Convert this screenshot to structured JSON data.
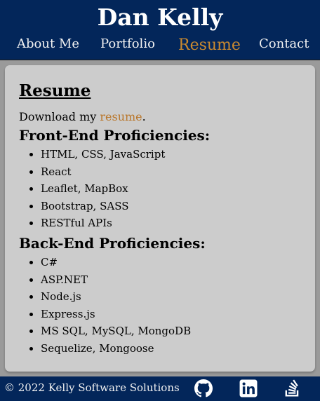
{
  "header": {
    "title": "Dan Kelly"
  },
  "nav": {
    "items": [
      {
        "label": "About Me"
      },
      {
        "label": "Portfolio"
      },
      {
        "label": "Resume"
      },
      {
        "label": "Contact"
      }
    ],
    "active": "Resume"
  },
  "main": {
    "heading": "Resume",
    "download_prefix": "Download my ",
    "download_link": "resume",
    "download_suffix": ".",
    "front_end": {
      "heading": "Front-End Proficiencies:",
      "items": [
        "HTML, CSS, JavaScript",
        "React",
        "Leaflet, MapBox",
        "Bootstrap, SASS",
        "RESTful APIs"
      ]
    },
    "back_end": {
      "heading": "Back-End Proficiencies:",
      "items": [
        "C#",
        "ASP.NET",
        "Node.js",
        "Express.js",
        "MS SQL, MySQL, MongoDB",
        "Sequelize, Mongoose"
      ]
    }
  },
  "footer": {
    "copyright": "© 2022 Kelly Software Solutions",
    "icons": [
      "github-icon",
      "linkedin-icon",
      "stack-overflow-icon"
    ]
  },
  "colors": {
    "header_bg": "#03265a",
    "page_bg": "#9a9a9a",
    "card_bg": "#cccccc",
    "active_nav": "#c9892f",
    "link": "#b9762a"
  }
}
